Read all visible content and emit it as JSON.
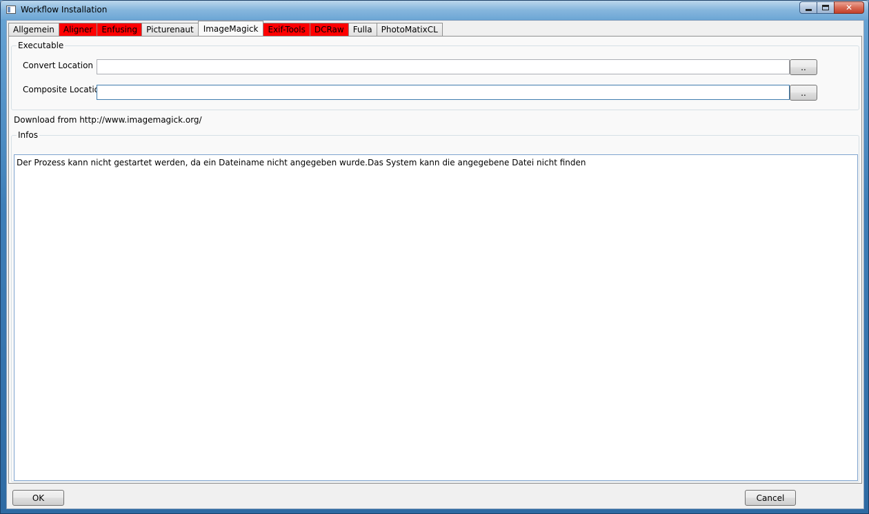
{
  "window": {
    "title": "Workflow Installation",
    "close_glyph": "✕"
  },
  "tabs": [
    {
      "label": "Allgemein",
      "state": "normal"
    },
    {
      "label": "Aligner",
      "state": "error"
    },
    {
      "label": "Enfusing",
      "state": "error"
    },
    {
      "label": "Picturenaut",
      "state": "normal"
    },
    {
      "label": "ImageMagick",
      "state": "active"
    },
    {
      "label": "Exif-Tools",
      "state": "error"
    },
    {
      "label": "DCRaw",
      "state": "error"
    },
    {
      "label": "Fulla",
      "state": "normal"
    },
    {
      "label": "PhotoMatixCL",
      "state": "normal"
    }
  ],
  "executable": {
    "legend": "Executable",
    "convert_label": "Convert Location",
    "convert_value": "",
    "composite_label": "Composite Location",
    "composite_value": "",
    "browse_label": ".."
  },
  "download_text": "Download from http://www.imagemagick.org/",
  "infos": {
    "legend": "Infos",
    "text": "Der Prozess kann nicht gestartet werden, da ein Dateiname nicht angegeben wurde.Das System kann die angegebene Datei nicht finden"
  },
  "footer": {
    "ok_label": "OK",
    "cancel_label": "Cancel"
  },
  "colors": {
    "error_tab": "#ff0000",
    "focus_border": "#3d7bad"
  },
  "icons": [
    "window-app-icon",
    "minimize-icon",
    "maximize-icon",
    "close-icon"
  ]
}
